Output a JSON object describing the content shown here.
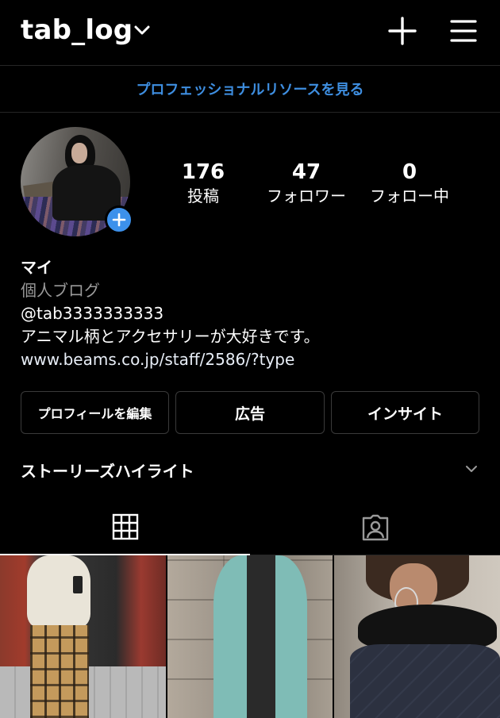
{
  "header": {
    "username": "tab_log",
    "icons": {
      "dropdown": "chevron-down-icon",
      "add": "plus-icon",
      "menu": "hamburger-menu-icon"
    }
  },
  "professional_link": "プロフェッショナルリソースを見る",
  "profile": {
    "avatar_icon": "avatar",
    "avatar_add_icon": "plus-circle-icon",
    "stats": {
      "posts_count": "176",
      "posts_label": "投稿",
      "followers_count": "47",
      "followers_label": "フォロワー",
      "following_count": "0",
      "following_label": "フォロー中"
    },
    "name": "マイ",
    "category": "個人ブログ",
    "handle": "@tab3333333333",
    "bio": "アニマル柄とアクセサリーが大好きです。",
    "website": "www.beams.co.jp/staff/2586/?type"
  },
  "actions": {
    "edit_profile": "プロフィールを編集",
    "ads": "広告",
    "insights": "インサイト"
  },
  "highlights": {
    "label": "ストーリーズハイライト",
    "icon": "chevron-down-icon"
  },
  "tabs": [
    {
      "name": "grid",
      "icon": "grid-icon",
      "active": true
    },
    {
      "name": "tagged",
      "icon": "tagged-person-icon",
      "active": false
    }
  ],
  "colors": {
    "background": "#000000",
    "accent_blue": "#3e8ee0",
    "secondary_text": "#9a9a9a",
    "button_border": "#3a3a3a"
  }
}
